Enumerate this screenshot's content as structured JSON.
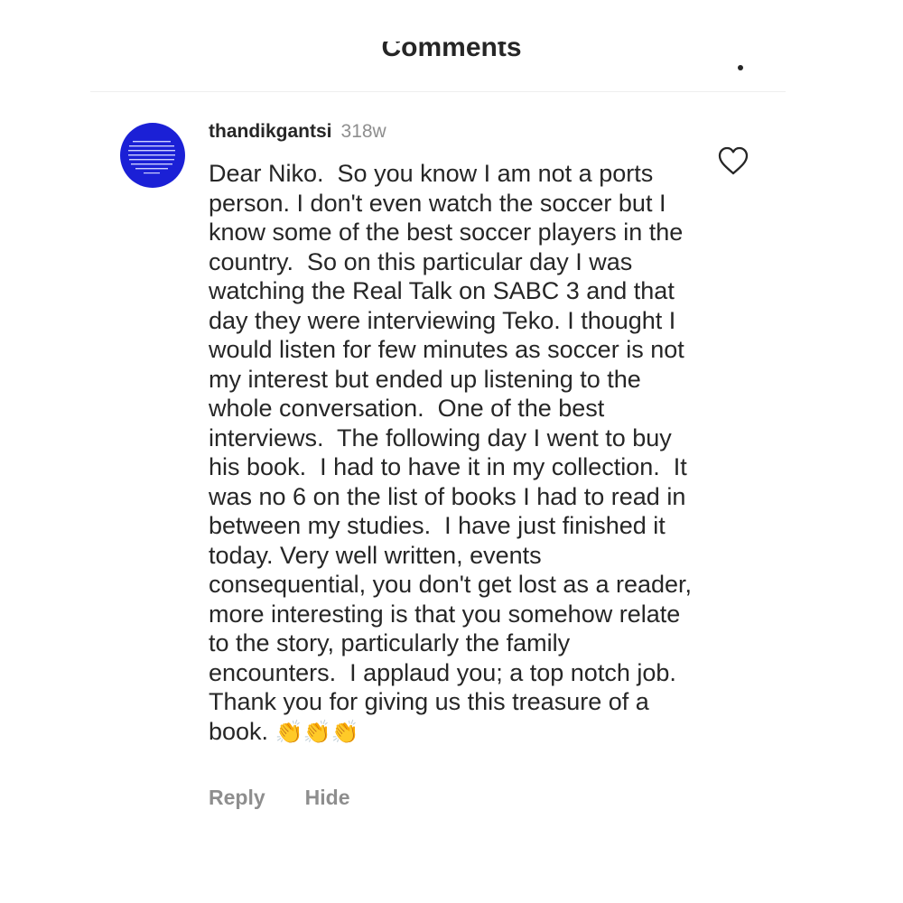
{
  "header": {
    "title": "Comments"
  },
  "icons": {
    "more": "vertical-dots-icon",
    "like": "heart-outline-icon"
  },
  "comment": {
    "username": "thandikgantsi",
    "time": "318w",
    "text": "Dear Niko.  So you know I am not a ports person. I don't even watch the soccer but I know some of the best soccer players in the country.  So on this particular day I was watching the Real Talk on SABC 3 and that day they were interviewing Teko. I thought I would listen for few minutes as soccer is not my interest but ended up listening to the whole conversation.  One of the best interviews.  The following day I went to buy his book.  I had to have it in my collection.  It was no 6 on the list of books I had to read in between my studies.  I have just finished it today. Very well written, events consequential, you don't get lost as a reader, more interesting is that you somehow relate to the story, particularly the family encounters.  I applaud you; a top notch job. Thank you for giving us this treasure of a book. ",
    "emoji": "👏👏👏"
  },
  "actions": {
    "reply": "Reply",
    "hide": "Hide"
  },
  "colors": {
    "avatar": "#1b20d6",
    "text": "#262626",
    "muted": "#8e8e8e"
  }
}
